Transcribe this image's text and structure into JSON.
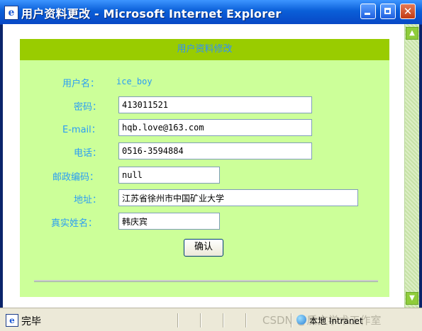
{
  "window": {
    "title": "用户资料更改 - Microsoft Internet Explorer"
  },
  "form": {
    "header": "用户资料修改",
    "username": {
      "label": "用户名：",
      "value": "ice_boy"
    },
    "password": {
      "label": "密码：",
      "value": "413011521"
    },
    "email": {
      "label": "E-mail：",
      "value": "hqb.love@163.com"
    },
    "phone": {
      "label": "电话：",
      "value": "0516-3594884"
    },
    "postcode": {
      "label": "邮政编码：",
      "value": "null"
    },
    "address": {
      "label": "地址：",
      "value": "江苏省徐州市中国矿业大学"
    },
    "realname": {
      "label": "真实姓名：",
      "value": "韩庆宾"
    },
    "submit_label": "确认"
  },
  "status": {
    "text": "完毕",
    "zone": "本地 Intranet",
    "watermark": "CSDN @质文学术工作室"
  },
  "colors": {
    "header_bg": "#99cc00",
    "panel_bg": "#ccff99",
    "label": "#2a9df4"
  }
}
